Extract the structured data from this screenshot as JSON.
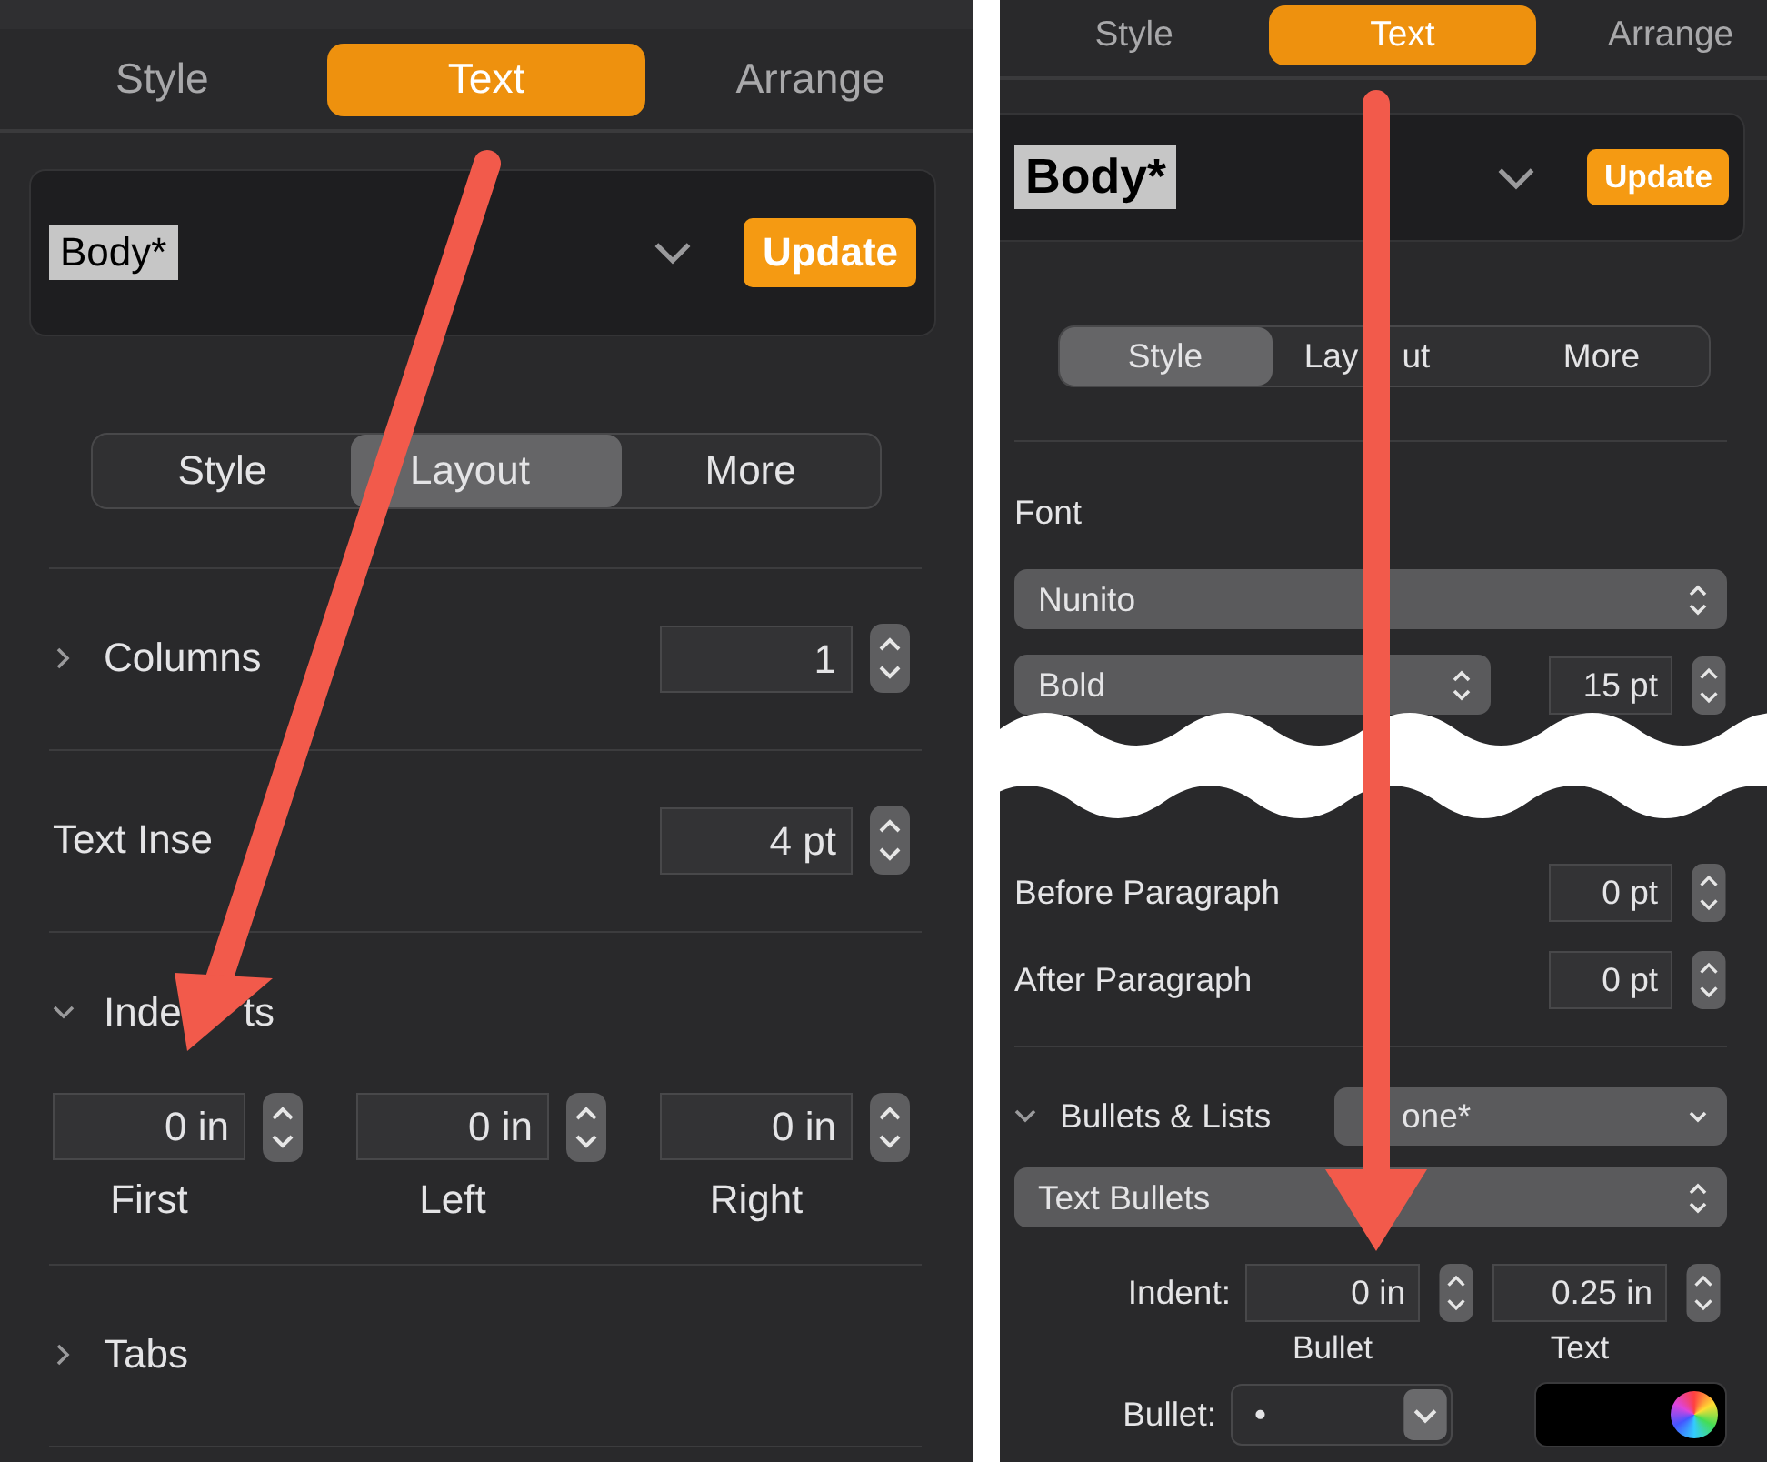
{
  "panels": [
    {
      "tabs": [
        {
          "label": "Style",
          "selected": false
        },
        {
          "label": "Text",
          "selected": true
        },
        {
          "label": "Arrange",
          "selected": false
        }
      ],
      "paragraph_style": "Body*",
      "update_button": "Update",
      "segments": [
        {
          "label": "Style",
          "selected": false
        },
        {
          "label": "Layout",
          "selected": true
        },
        {
          "label": "More",
          "selected": false
        }
      ],
      "sections": [
        {
          "kind": "rule"
        },
        {
          "kind": "stepper_row",
          "label": "Columns",
          "expanded": false,
          "value": "1"
        },
        {
          "kind": "rule"
        },
        {
          "kind": "stepper_row",
          "label": "Text Inse",
          "value": "4 pt"
        },
        {
          "kind": "rule"
        },
        {
          "kind": "fields",
          "label_parts": [
            "Inde",
            "ts"
          ],
          "expanded": true,
          "fields": [
            {
              "value": "0 in",
              "caption": "First"
            },
            {
              "value": "0 in",
              "caption": "Left"
            },
            {
              "value": "0 in",
              "caption": "Right"
            }
          ]
        },
        {
          "kind": "rule"
        },
        {
          "kind": "stepper_row",
          "label": "Tabs",
          "expanded": false
        },
        {
          "kind": "rule"
        }
      ]
    },
    {
      "tabs": [
        {
          "label": "Style",
          "selected": false
        },
        {
          "label": "Text",
          "selected": true
        },
        {
          "label": "Arrange",
          "selected": false
        }
      ],
      "paragraph_style": "Body*",
      "update_button": "Update",
      "segments": [
        {
          "label": "Style",
          "selected": true
        },
        {
          "label_parts": [
            "Lay",
            "ut"
          ],
          "selected": false
        },
        {
          "label": "More",
          "selected": false
        }
      ],
      "sections": [
        {
          "kind": "rule"
        },
        {
          "kind": "heading",
          "label": "Font"
        },
        {
          "kind": "popup",
          "value": "Nunito"
        },
        {
          "kind": "popup_stepper",
          "value": "Bold",
          "size": "15 pt"
        },
        {
          "kind": "break"
        },
        {
          "kind": "stepper_row",
          "label": "Before Paragraph",
          "value": "0 pt"
        },
        {
          "kind": "stepper_row",
          "label": "After Paragraph",
          "value": "0 pt"
        },
        {
          "kind": "rule"
        },
        {
          "kind": "dropdown_row",
          "label": "Bullets & Lists",
          "expanded": true,
          "value": "one*"
        },
        {
          "kind": "popup",
          "value": "Text Bullets"
        },
        {
          "kind": "fields",
          "label": "Indent:",
          "fields": [
            {
              "value": "0 in",
              "caption": "Bullet"
            },
            {
              "value": "0.25 in",
              "caption": "Text"
            }
          ]
        },
        {
          "kind": "bullet_row",
          "label": "Bullet:",
          "value": "•"
        }
      ]
    }
  ]
}
